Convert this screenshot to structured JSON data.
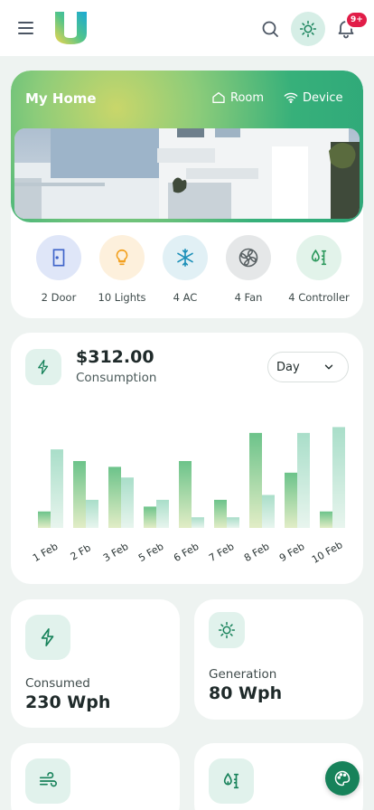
{
  "header": {
    "notification_badge": "9+",
    "icons": [
      "menu-icon",
      "logo",
      "search-icon",
      "sun-icon",
      "bell-icon"
    ]
  },
  "home": {
    "title": "My Home",
    "tabs": [
      {
        "label": "Room",
        "icon": "house-icon"
      },
      {
        "label": "Device",
        "icon": "wifi-icon"
      }
    ]
  },
  "devices": [
    {
      "label": "2 Door",
      "icon": "door-icon",
      "color": "#dfe6f8",
      "stroke": "#3e63c9"
    },
    {
      "label": "10 Lights",
      "icon": "bulb-icon",
      "color": "#fdf0dc",
      "stroke": "#f29f1c"
    },
    {
      "label": "4 AC",
      "icon": "snowflake-icon",
      "color": "#e1f0f5",
      "stroke": "#1b8fb8"
    },
    {
      "label": "4 Fan",
      "icon": "fan-icon",
      "color": "#e5e7e8",
      "stroke": "#5a6265"
    },
    {
      "label": "4 Controller",
      "icon": "controller-icon",
      "color": "#e2f3ea",
      "stroke": "#2e9a5e"
    }
  ],
  "consumption": {
    "amount": "$312.00",
    "label": "Consumption",
    "period": "Day"
  },
  "chart_data": {
    "type": "bar",
    "categories": [
      "1 Feb",
      "2 Fb",
      "3 Feb",
      "5 Feb",
      "6 Feb",
      "7 Feb",
      "8 Feb",
      "9 Feb",
      "10 Feb"
    ],
    "series": [
      {
        "values": [
          17,
          69,
          63,
          22,
          69,
          29,
          98,
          57,
          17
        ]
      },
      {
        "values": [
          81,
          29,
          52,
          29,
          11,
          11,
          34,
          98,
          104
        ]
      }
    ],
    "ylim": [
      0,
      110
    ],
    "grid": false,
    "colors": [
      "#6cc38a",
      "#a9dec9"
    ]
  },
  "stats": [
    {
      "label": "Consumed",
      "value": "230 Wph",
      "icon": "bolt-icon"
    },
    {
      "label": "Generation",
      "value": "80 Wph",
      "icon": "sun-icon"
    },
    {
      "icon": "wind-icon"
    },
    {
      "icon": "controller-icon"
    }
  ],
  "fab": {
    "icon": "palette-icon"
  }
}
